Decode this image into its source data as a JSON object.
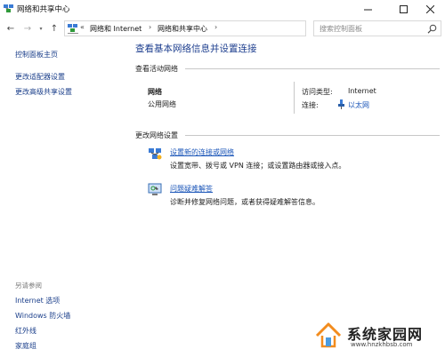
{
  "window": {
    "title": "网络和共享中心"
  },
  "address": {
    "overflow": "«",
    "crumbs": [
      "网络和 Internet",
      "网络和共享中心"
    ],
    "separator": "›"
  },
  "search": {
    "placeholder": "搜索控制面板"
  },
  "sidebar": {
    "top_links": [
      "控制面板主页",
      "更改适配器设置",
      "更改高级共享设置"
    ],
    "see_also_heading": "另请参阅",
    "see_also_links": [
      "Internet 选项",
      "Windows 防火墙",
      "红外线",
      "家庭组"
    ]
  },
  "main": {
    "title": "查看基本网络信息并设置连接",
    "active_heading": "查看活动网络",
    "network_name": "网络",
    "network_type": "公用网络",
    "access_label": "访问类型:",
    "access_value": "Internet",
    "connection_label": "连接:",
    "connection_value": "以太网",
    "change_heading": "更改网络设置",
    "tasks": [
      {
        "link": "设置新的连接或网络",
        "desc": "设置宽带、拨号或 VPN 连接；或设置路由器或接入点。",
        "icon": "network-setup-icon"
      },
      {
        "link": "问题疑难解答",
        "desc": "诊断并修复网络问题，或者获得疑难解答信息。",
        "icon": "troubleshoot-icon"
      }
    ]
  },
  "watermark": {
    "title": "系统家园网",
    "url": "www.hnzkhbsb.com"
  },
  "colors": {
    "link": "#1a55b8",
    "title_blue": "#1e3f8f",
    "watermark_orange": "#f28c1e"
  }
}
